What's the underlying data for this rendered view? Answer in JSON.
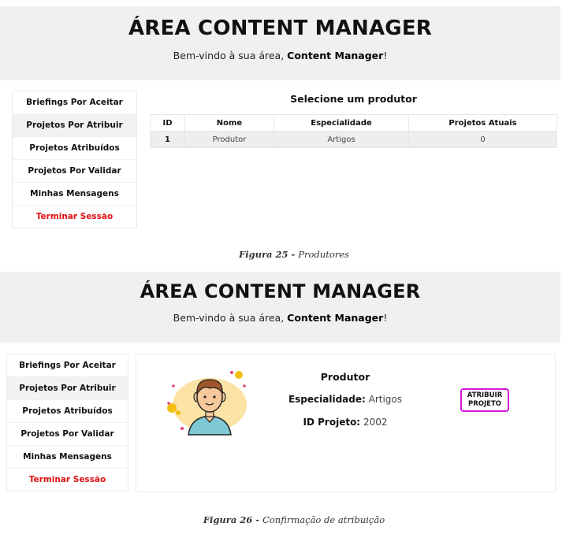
{
  "figure25": {
    "header": {
      "title": "ÁREA CONTENT MANAGER",
      "welcome_prefix": "Bem-vindo à sua área, ",
      "welcome_role": "Content Manager",
      "welcome_suffix": "!"
    },
    "sidebar": {
      "items": [
        {
          "label": "Briefings Por Aceitar"
        },
        {
          "label": "Projetos Por Atribuir"
        },
        {
          "label": "Projetos Atribuídos"
        },
        {
          "label": "Projetos Por Validar"
        },
        {
          "label": "Minhas Mensagens"
        },
        {
          "label": "Terminar Sessão"
        }
      ]
    },
    "main": {
      "heading": "Selecione um produtor",
      "table": {
        "headers": [
          "ID",
          "Nome",
          "Especialidade",
          "Projetos Atuais"
        ],
        "rows": [
          {
            "id": "1",
            "nome": "Produtor",
            "especialidade": "Artigos",
            "projetos": "0"
          }
        ]
      }
    },
    "caption": {
      "number": "Figura 25 - ",
      "text": "Produtores"
    }
  },
  "figure26": {
    "header": {
      "title": "ÁREA CONTENT MANAGER",
      "welcome_prefix": "Bem-vindo à sua área, ",
      "welcome_role": "Content Manager",
      "welcome_suffix": "!"
    },
    "sidebar": {
      "items": [
        {
          "label": "Briefings Por Aceitar"
        },
        {
          "label": "Projetos Por Atribuir"
        },
        {
          "label": "Projetos Atribuídos"
        },
        {
          "label": "Projetos Por Validar"
        },
        {
          "label": "Minhas Mensagens"
        },
        {
          "label": "Terminar Sessão"
        }
      ]
    },
    "card": {
      "name": "Produtor",
      "specialty_label": "Especialidade:",
      "specialty_value": "Artigos",
      "project_label": "ID Projeto:",
      "project_value": "2002",
      "assign_line1": "ATRIBUIR",
      "assign_line2": "PROJETO",
      "avatar_icon": "user-avatar-icon"
    },
    "caption": {
      "number": "Figura 26 - ",
      "text": "Confirmação de atribuição"
    }
  },
  "colors": {
    "banner_bg": "#f0f0f0",
    "logout_red": "#e01010",
    "assign_border": "#d41ad4",
    "row_bg": "#eeeeee"
  }
}
